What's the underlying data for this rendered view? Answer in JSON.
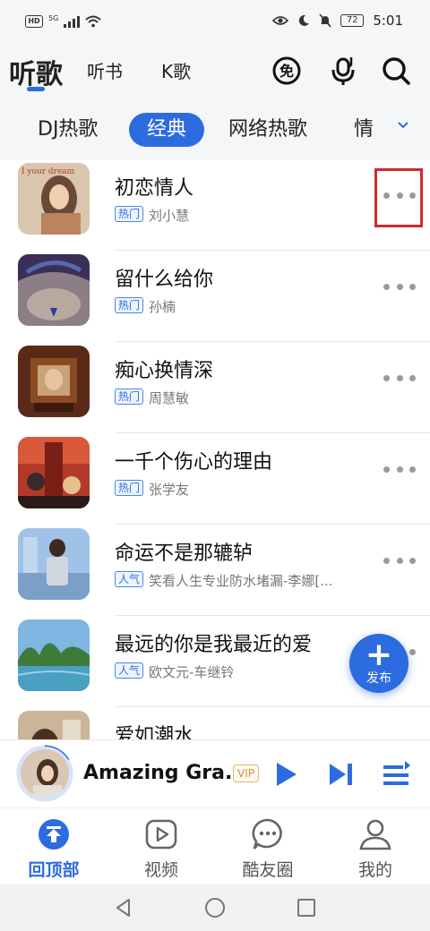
{
  "status_bar": {
    "hd": "HD",
    "signal_text": "5G",
    "battery": "72",
    "time": "5:01"
  },
  "top_nav": {
    "tabs": [
      "听歌",
      "听书",
      "K歌"
    ],
    "active_tab": "听歌",
    "icons": [
      "free-icon",
      "mic-icon",
      "search-icon"
    ],
    "free_badge": "免"
  },
  "categories": {
    "items": [
      "DJ热歌",
      "经典",
      "网络热歌",
      "情"
    ],
    "active": "经典"
  },
  "songs": [
    {
      "title": "初恋情人",
      "tag": "热门",
      "artist": "刘小慧",
      "cover_text": "I your dream"
    },
    {
      "title": "留什么给你",
      "tag": "热门",
      "artist": "孙楠",
      "cover_text": ""
    },
    {
      "title": "痴心换情深",
      "tag": "热门",
      "artist": "周慧敏",
      "cover_text": ""
    },
    {
      "title": "一千个伤心的理由",
      "tag": "热门",
      "artist": "张学友",
      "cover_text": ""
    },
    {
      "title": "命运不是那辘轳",
      "tag": "人气",
      "artist": "笑看人生专业防水堵漏-李娜[...",
      "cover_text": ""
    },
    {
      "title": "最远的你是我最近的爱",
      "tag": "人气",
      "artist": "欧文元-车继铃",
      "cover_text": ""
    },
    {
      "title": "爱如潮水",
      "tag": "",
      "artist": "",
      "cover_text": ""
    }
  ],
  "fab": {
    "plus": "+",
    "label": "发布"
  },
  "player": {
    "title": "Amazing Gra...",
    "vip": "VIP"
  },
  "tabbar": {
    "items": [
      "回顶部",
      "视频",
      "酷友圈",
      "我的"
    ],
    "active": "回顶部"
  },
  "colors": {
    "accent": "#2d6be0",
    "highlight": "#d0282f"
  }
}
